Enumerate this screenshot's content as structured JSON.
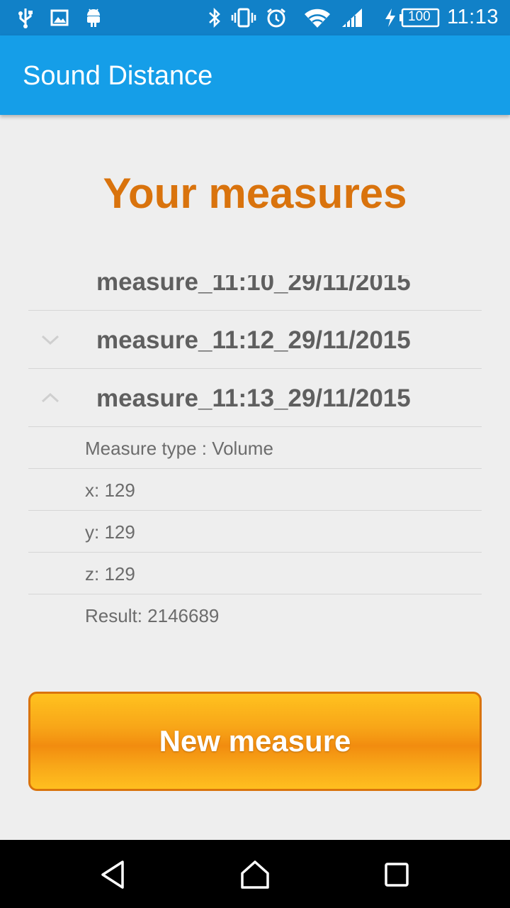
{
  "status_bar": {
    "time": "11:13",
    "battery_level": "100",
    "icons": [
      "usb-icon",
      "image-icon",
      "android-icon",
      "bluetooth-icon",
      "vibrate-icon",
      "alarm-icon",
      "wifi-icon",
      "signal-icon",
      "charging-icon",
      "battery-icon"
    ]
  },
  "app_bar": {
    "title": "Sound Distance"
  },
  "main": {
    "heading": "Your measures",
    "measures": [
      {
        "label": "measure_11:10_29/11/2015",
        "expanded": false
      },
      {
        "label": "measure_11:12_29/11/2015",
        "expanded": false
      },
      {
        "label": "measure_11:13_29/11/2015",
        "expanded": true
      }
    ],
    "details": {
      "type": "Measure type : Volume",
      "x": "x: 129",
      "y": "y: 129",
      "z": "z: 129",
      "result": "Result: 2146689"
    },
    "new_button": "New measure"
  },
  "colors": {
    "app_bar": "#159ee8",
    "status_bar": "#1181c8",
    "accent": "#d9730d",
    "button": "#f8a618"
  }
}
